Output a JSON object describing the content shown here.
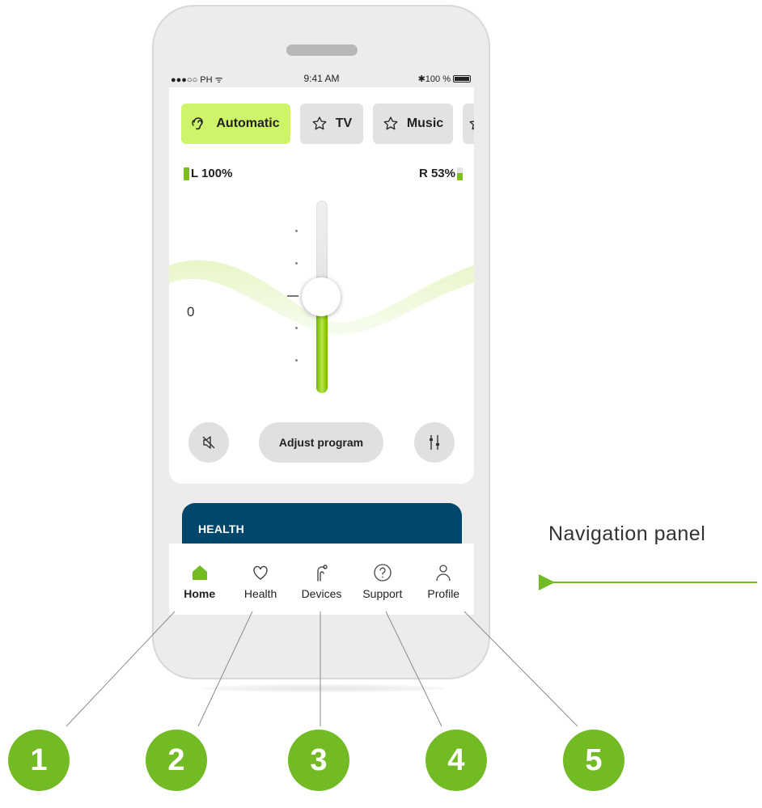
{
  "status_bar": {
    "carrier": "●●●○○ PH ᯤ",
    "time": "9:41 AM",
    "battery": "✱100 %"
  },
  "programs": {
    "tabs": [
      {
        "label": "Automatic",
        "icon": "ear-icon",
        "active": true
      },
      {
        "label": "TV",
        "icon": "star-icon",
        "active": false
      },
      {
        "label": "Music",
        "icon": "star-icon",
        "active": false
      }
    ]
  },
  "battery_levels": {
    "left_label": "L 100%",
    "left_level": 1.0,
    "right_label": "R 53%",
    "right_level": 0.53
  },
  "volume": {
    "value_label": "0",
    "level": 0.5
  },
  "controls": {
    "mute_icon": "speaker-mute-icon",
    "adjust_label": "Adjust program",
    "equalizer_icon": "sliders-icon"
  },
  "health_card": {
    "title": "HEALTH"
  },
  "navigation": {
    "items": [
      {
        "label": "Home",
        "icon": "home-icon",
        "active": true
      },
      {
        "label": "Health",
        "icon": "heart-icon",
        "active": false
      },
      {
        "label": "Devices",
        "icon": "hearing-aid-icon",
        "active": false
      },
      {
        "label": "Support",
        "icon": "question-icon",
        "active": false
      },
      {
        "label": "Profile",
        "icon": "person-icon",
        "active": false
      }
    ]
  },
  "annotation": {
    "text": "Navigation panel",
    "callouts": [
      "1",
      "2",
      "3",
      "4",
      "5"
    ]
  },
  "colors": {
    "accent_green": "#72bb25",
    "active_tab": "#cdf46a",
    "health_card": "#00476b"
  }
}
